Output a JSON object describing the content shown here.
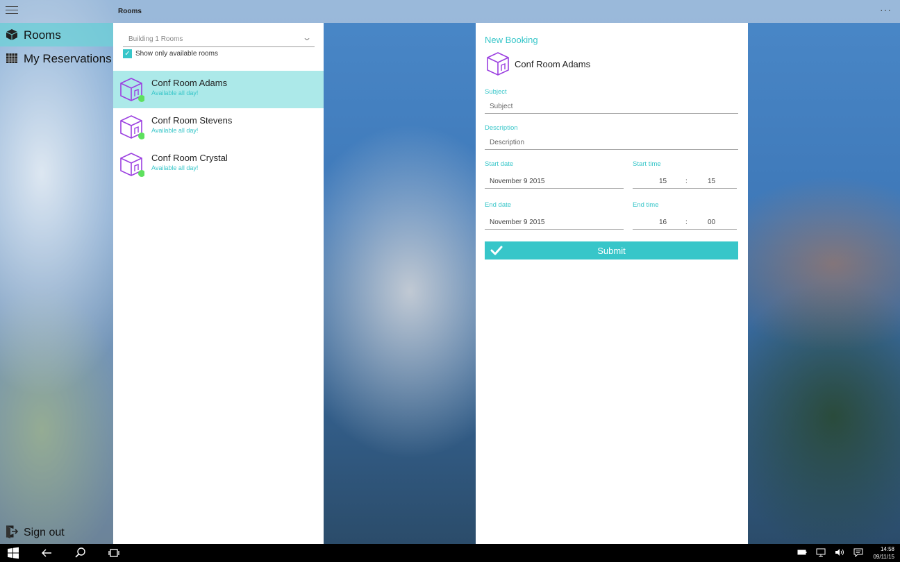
{
  "window": {
    "title": "Rooms",
    "more_icon": "more-dots-icon"
  },
  "nav": {
    "items": [
      {
        "label": "Rooms",
        "icon": "cube-icon",
        "active": true
      },
      {
        "label": "My Reservations",
        "icon": "calendar-grid-icon",
        "active": false
      }
    ],
    "sign_out_label": "Sign out"
  },
  "list": {
    "building_select": "Building 1 Rooms",
    "checkbox_label": "Show only available rooms",
    "checkbox_checked": true,
    "rooms": [
      {
        "name": "Conf Room Adams",
        "status": "Available all day!",
        "selected": true
      },
      {
        "name": "Conf Room Stevens",
        "status": "Available all day!",
        "selected": false
      },
      {
        "name": "Conf Room Crystal",
        "status": "Available all day!",
        "selected": false
      }
    ]
  },
  "booking": {
    "title": "New Booking",
    "room_name": "Conf Room Adams",
    "subject_label": "Subject",
    "subject_placeholder": "Subject",
    "description_label": "Description",
    "description_placeholder": "Description",
    "start_date_label": "Start date",
    "start_date": "November 9 2015",
    "start_time_label": "Start time",
    "start_hour": "15",
    "start_minute": "15",
    "end_date_label": "End date",
    "end_date": "November 9 2015",
    "end_time_label": "End time",
    "end_hour": "16",
    "end_minute": "00",
    "time_separator": ":",
    "submit_label": "Submit"
  },
  "taskbar": {
    "time": "14:58",
    "date": "09/11/15"
  },
  "colors": {
    "accent": "#37c6c9",
    "selected_row": "#ace9e9",
    "cube_purple": "#9b3fe0",
    "available_dot": "#5ee05e"
  }
}
